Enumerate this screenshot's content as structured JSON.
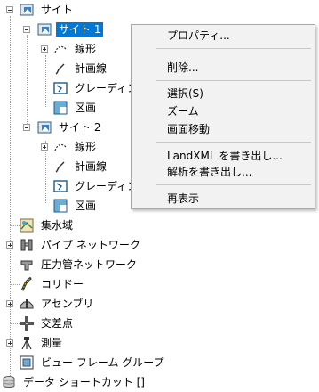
{
  "tree": {
    "root": {
      "label": "サイト",
      "icon": "site-folder-icon"
    },
    "site1": {
      "label": "サイト 1",
      "icon": "site-icon"
    },
    "site1_children": [
      {
        "label": "線形",
        "icon": "alignment-icon"
      },
      {
        "label": "計画線",
        "icon": "feature-line-icon"
      },
      {
        "label": "グレーディング",
        "icon": "grading-icon"
      },
      {
        "label": "区画",
        "icon": "parcel-icon"
      }
    ],
    "site2": {
      "label": "サイト 2",
      "icon": "site-icon"
    },
    "site2_children": [
      {
        "label": "線形",
        "icon": "alignment-icon"
      },
      {
        "label": "計画線",
        "icon": "feature-line-icon"
      },
      {
        "label": "グレーディング",
        "icon": "grading-icon"
      },
      {
        "label": "区画",
        "icon": "parcel-icon"
      }
    ],
    "items": [
      {
        "label": "集水域",
        "icon": "catchment-icon"
      },
      {
        "label": "パイプ ネットワーク",
        "icon": "pipe-network-icon"
      },
      {
        "label": "圧力管ネットワーク",
        "icon": "pressure-network-icon"
      },
      {
        "label": "コリドー",
        "icon": "corridor-icon"
      },
      {
        "label": "アセンブリ",
        "icon": "assembly-icon"
      },
      {
        "label": "交差点",
        "icon": "intersection-icon"
      },
      {
        "label": "測量",
        "icon": "survey-icon"
      },
      {
        "label": "ビュー フレーム グループ",
        "icon": "view-frame-group-icon"
      }
    ],
    "shortcuts": {
      "label": "データ ショートカット []",
      "icon": "data-shortcut-icon"
    }
  },
  "context_menu": {
    "properties": "プロパティ...",
    "delete": "削除...",
    "select": "選択(S)",
    "zoom": "ズーム",
    "pan": "画面移動",
    "export_landxml": "LandXML を書き出し...",
    "export_analysis": "解析を書き出し...",
    "refresh": "再表示"
  },
  "colors": {
    "selection": "#0078d7",
    "menu_bg": "#f2f2f2"
  }
}
